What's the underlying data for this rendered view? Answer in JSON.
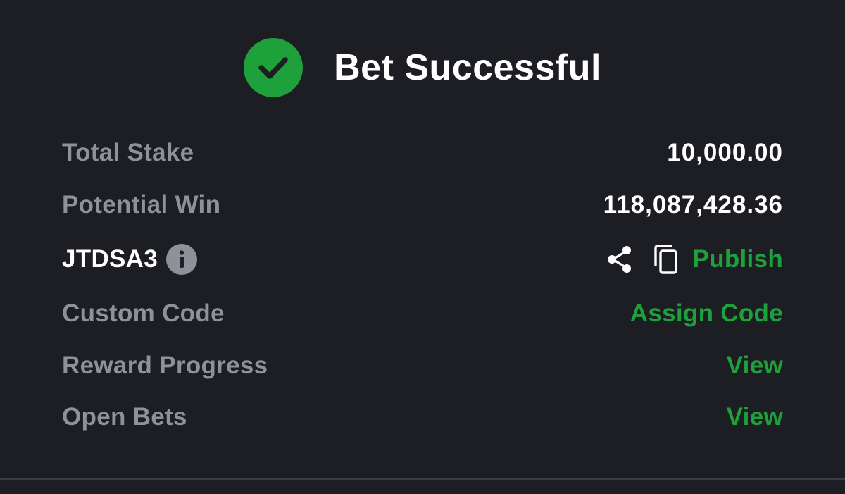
{
  "header": {
    "title": "Bet Successful"
  },
  "rows": {
    "total_stake": {
      "label": "Total Stake",
      "value": "10,000.00"
    },
    "potential_win": {
      "label": "Potential Win",
      "value": "118,087,428.36"
    },
    "booking_code": {
      "code": "JTDSA3",
      "action": "Publish"
    },
    "custom_code": {
      "label": "Custom Code",
      "action": "Assign Code"
    },
    "reward_progress": {
      "label": "Reward Progress",
      "action": "View"
    },
    "open_bets": {
      "label": "Open Bets",
      "action": "View"
    }
  },
  "icons": {
    "success": "check-circle-icon",
    "info": "info-icon",
    "share": "share-icon",
    "copy": "copy-icon"
  },
  "colors": {
    "background": "#1c1e24",
    "accent_green": "#1ea13a",
    "label_gray": "#8e919a",
    "text_white": "#ffffff"
  }
}
